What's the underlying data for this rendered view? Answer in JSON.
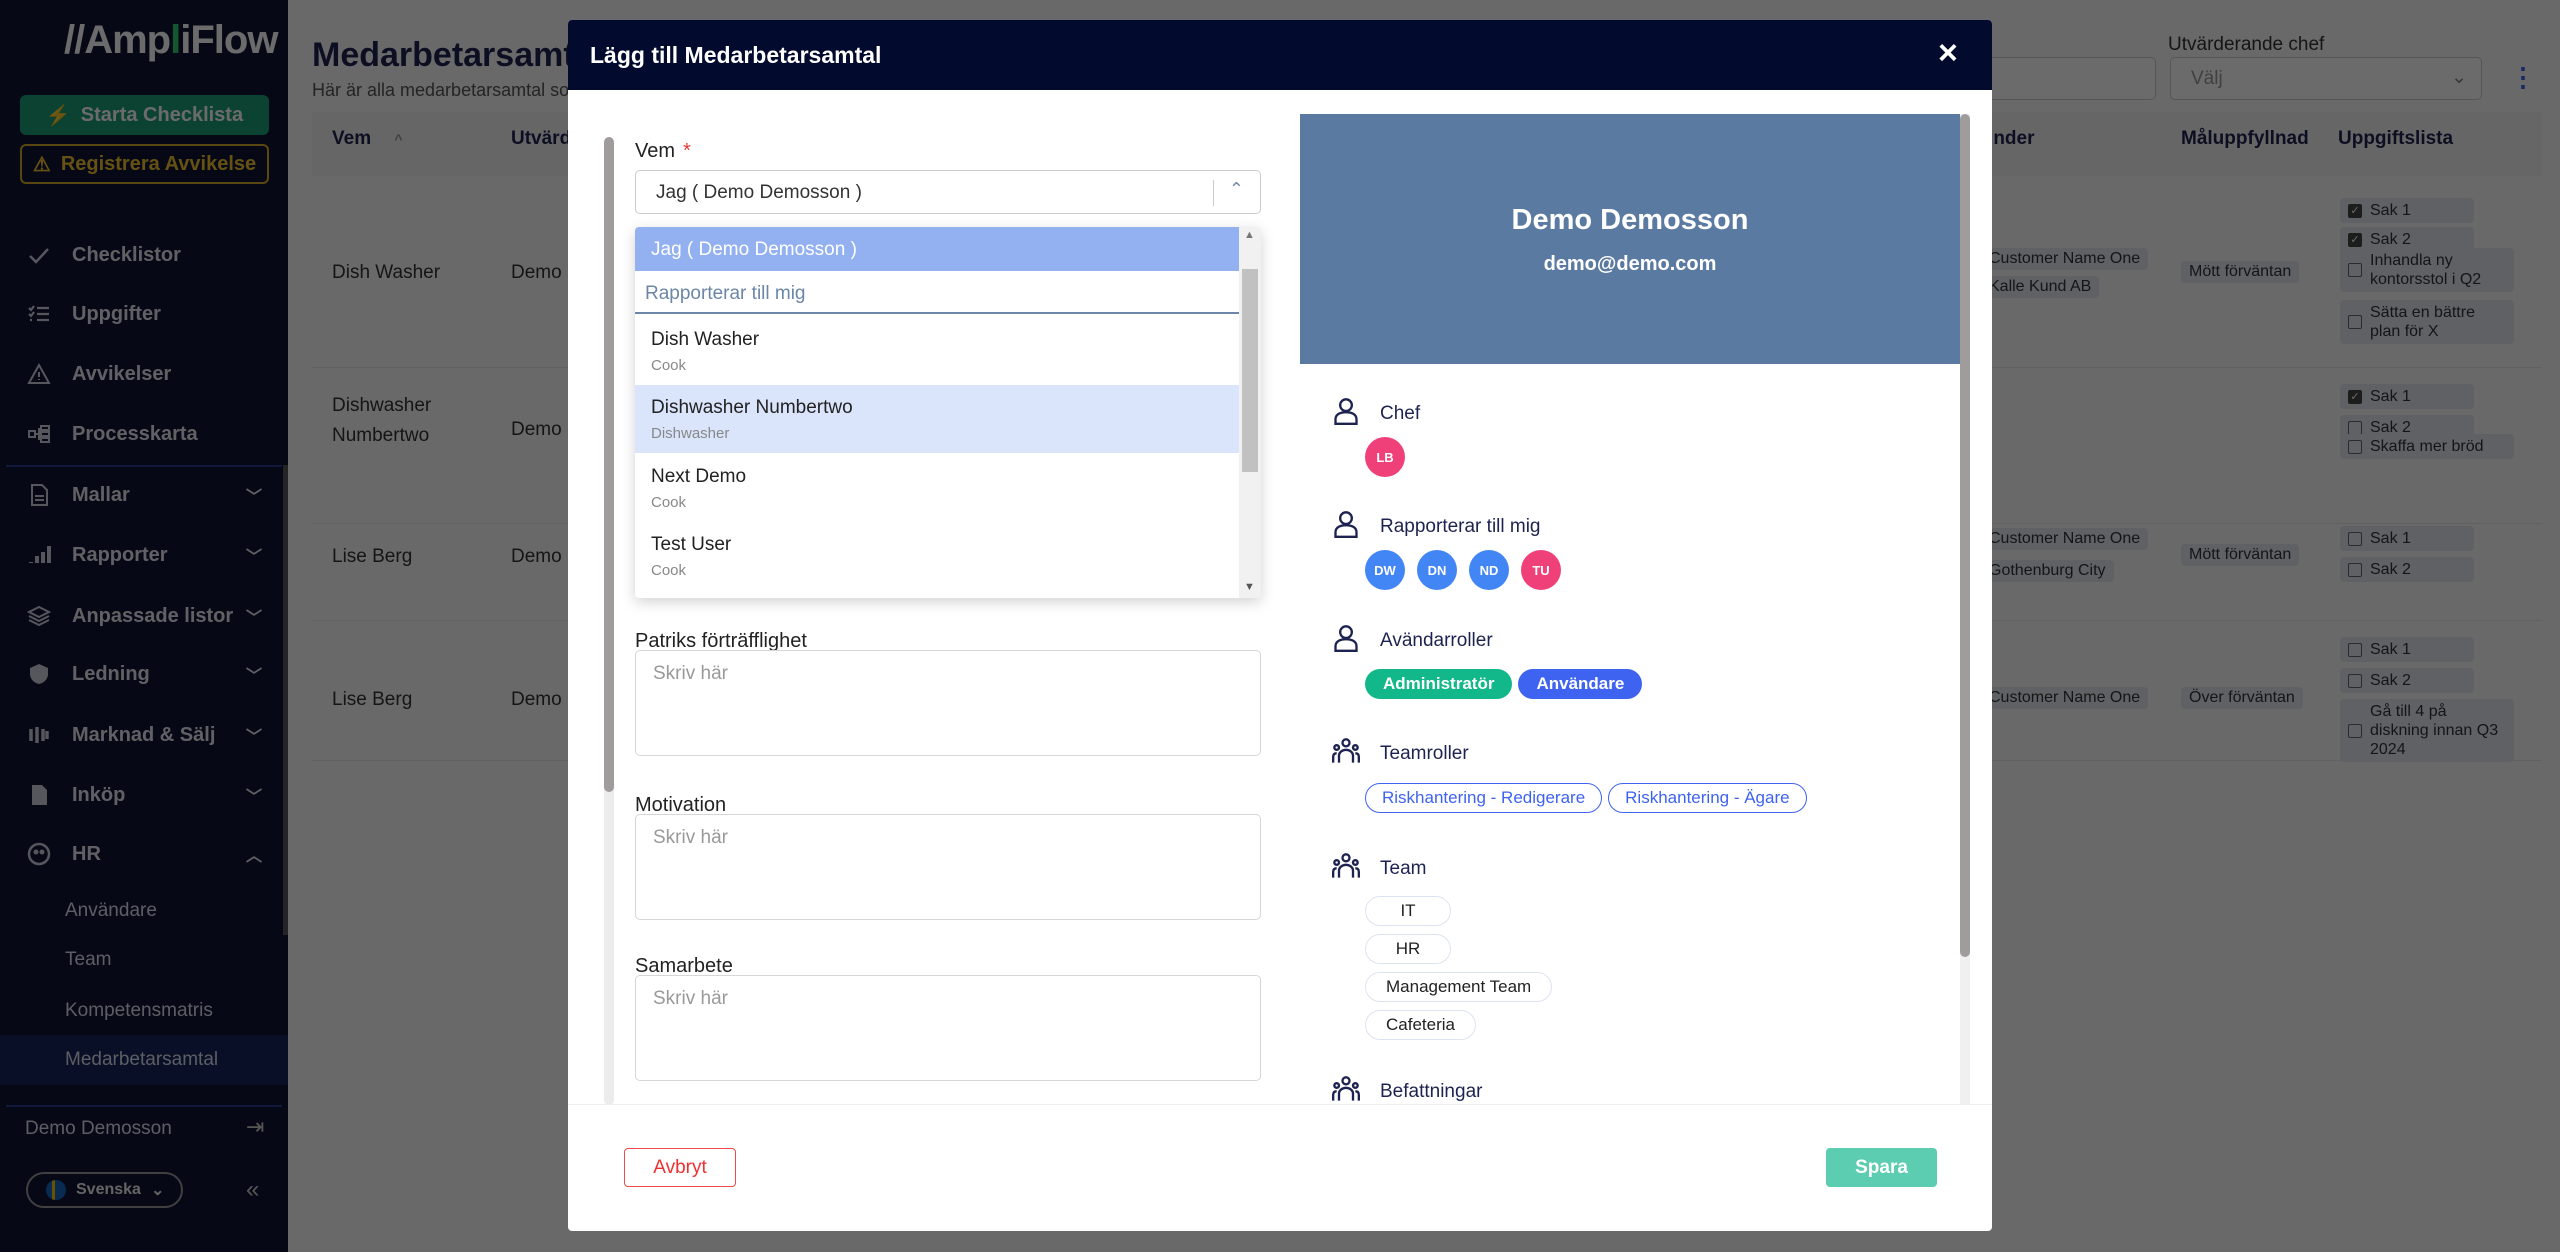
{
  "sidebar": {
    "logo": "AmpliFlow",
    "start_checklist": "Starta Checklista",
    "register_deviation": "Registrera Avvikelse",
    "items": [
      {
        "label": "Checklistor",
        "icon": "check-icon"
      },
      {
        "label": "Uppgifter",
        "icon": "tasks-icon"
      },
      {
        "label": "Avvikelser",
        "icon": "warning-icon"
      },
      {
        "label": "Processkarta",
        "icon": "process-map-icon"
      },
      {
        "label": "Mallar",
        "icon": "document-icon"
      },
      {
        "label": "Rapporter",
        "icon": "bar-chart-icon"
      },
      {
        "label": "Anpassade listor",
        "icon": "layers-icon"
      },
      {
        "label": "Ledning",
        "icon": "shield-user-icon"
      },
      {
        "label": "Marknad & Sälj",
        "icon": "marketing-icon"
      },
      {
        "label": "Inköp",
        "icon": "invoice-icon"
      },
      {
        "label": "HR",
        "icon": "people-icon"
      }
    ],
    "hr_sub": [
      "Användare",
      "Team",
      "Kompetensmatris",
      "Medarbetarsamtal"
    ],
    "user": "Demo Demosson",
    "language": "Svenska"
  },
  "page": {
    "title": "Medarbetarsamtal",
    "subtitle": "Här är alla medarbetarsamtal som",
    "filter_label": "Utvärderande chef",
    "filter_placeholder": "Välj",
    "columns": [
      "Vem",
      "Utvärderande chef",
      "Kunder",
      "Måluppfyllnad",
      "Uppgiftslista"
    ],
    "rows": [
      {
        "who": "Dish Washer",
        "evaluator": "Demo Demosson",
        "customers": [
          "Customer Name One",
          "Kalle Kund AB"
        ],
        "goal": "Mött förväntan",
        "tasks": [
          {
            "t": "Sak 1",
            "done": true
          },
          {
            "t": "Sak 2",
            "done": true
          },
          {
            "t": "Inhandla ny kontorsstol i Q2",
            "done": false
          },
          {
            "t": "Sätta en bättre plan för X",
            "done": false
          }
        ]
      },
      {
        "who": "Dishwasher Numbertwo",
        "evaluator": "Demo Demosson",
        "customers": [],
        "goal": "",
        "tasks": [
          {
            "t": "Sak 1",
            "done": true
          },
          {
            "t": "Sak 2",
            "done": false
          },
          {
            "t": "Skaffa mer bröd",
            "done": false
          }
        ]
      },
      {
        "who": "Lise Berg",
        "evaluator": "Demo Demosson",
        "customers": [
          "Customer Name One",
          "Gothenburg City"
        ],
        "goal": "Mött förväntan",
        "tasks": [
          {
            "t": "Sak 1",
            "done": false
          },
          {
            "t": "Sak 2",
            "done": false
          }
        ]
      },
      {
        "who": "Lise Berg",
        "evaluator": "Demo Demosson",
        "customers": [
          "Customer Name One"
        ],
        "goal": "Över förväntan",
        "tasks": [
          {
            "t": "Sak 1",
            "done": false
          },
          {
            "t": "Sak 2",
            "done": false
          },
          {
            "t": "Gå till 4 på diskning innan Q3 2024",
            "done": false
          }
        ]
      }
    ]
  },
  "modal": {
    "title": "Lägg till Medarbetarsamtal",
    "who_label": "Vem",
    "who_value": "Jag ( Demo Demosson )",
    "dropdown": {
      "selected": "Jag ( Demo Demosson )",
      "group": "Rapporterar till mig",
      "options": [
        {
          "name": "Dish Washer",
          "role": "Cook"
        },
        {
          "name": "Dishwasher Numbertwo",
          "role": "Dishwasher"
        },
        {
          "name": "Next Demo",
          "role": "Cook"
        },
        {
          "name": "Test User",
          "role": "Cook"
        }
      ]
    },
    "fields": [
      {
        "label": "Patriks förträfflighet",
        "placeholder": "Skriv här"
      },
      {
        "label": "Motivation",
        "placeholder": "Skriv här"
      },
      {
        "label": "Samarbete",
        "placeholder": "Skriv här"
      }
    ],
    "profile": {
      "name": "Demo Demosson",
      "email": "demo@demo.com",
      "chef_label": "Chef",
      "chef": [
        {
          "initials": "LB",
          "color": "#f0407a"
        }
      ],
      "reports_label": "Rapporterar till mig",
      "reports": [
        {
          "initials": "DW",
          "color": "#4285f4"
        },
        {
          "initials": "DN",
          "color": "#4285f4"
        },
        {
          "initials": "ND",
          "color": "#4285f4"
        },
        {
          "initials": "TU",
          "color": "#f0407a"
        }
      ],
      "roles_label": "Avändarroller",
      "roles": [
        {
          "label": "Administratör",
          "color": "#13b88a"
        },
        {
          "label": "Användare",
          "color": "#3e63f0"
        }
      ],
      "team_roles_label": "Teamroller",
      "team_roles": [
        "Riskhantering - Redigerare",
        "Riskhantering - Ägare"
      ],
      "team_label": "Team",
      "teams": [
        "IT",
        "HR",
        "Management Team",
        "Cafeteria"
      ],
      "positions_label": "Befattningar"
    },
    "cancel": "Avbryt",
    "save": "Spara"
  }
}
